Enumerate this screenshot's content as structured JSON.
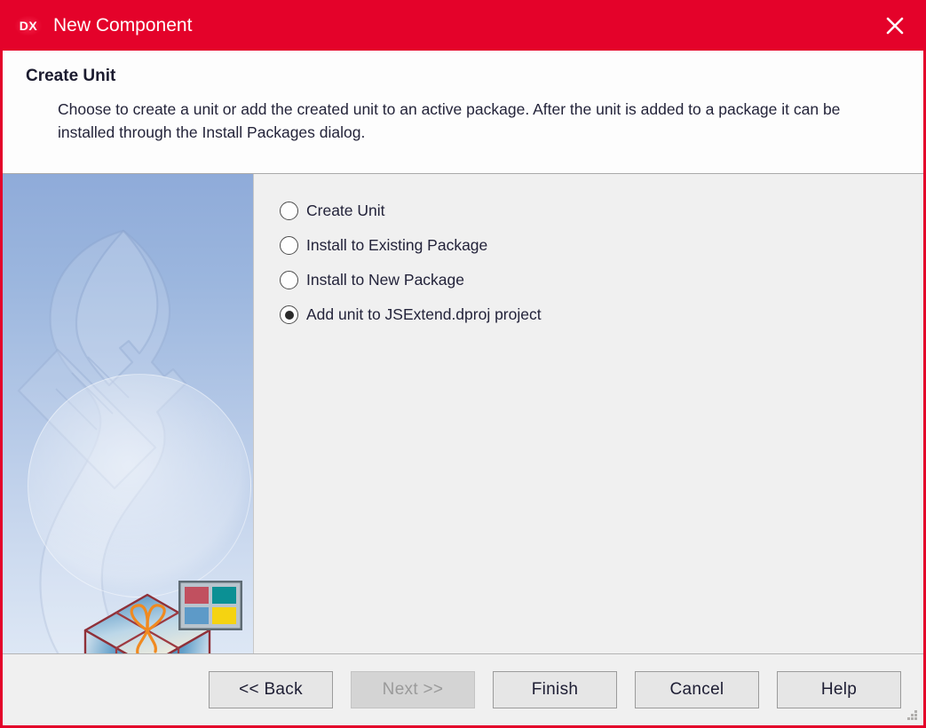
{
  "window": {
    "logo_text": "DX",
    "title": "New Component",
    "close_label": "✕",
    "accent_color": "#e4022a",
    "content_bg": "#f0f0f0"
  },
  "header": {
    "title": "Create Unit",
    "description": "Choose to create a unit or add the created unit to an active package. After the unit is added to a package it can be installed through the Install Packages dialog."
  },
  "side_panel": {
    "wrench_icon": "wrench-watermark-icon",
    "gift_icon": "gift-box-icon",
    "squares_icon": "four-color-squares-icon",
    "square_colors": [
      "#c1505f",
      "#0b9094",
      "#5d9ac8",
      "#f5d311"
    ]
  },
  "options": {
    "group_name": "create-unit-options",
    "items": [
      {
        "label": "Create Unit",
        "selected": false
      },
      {
        "label": "Install to Existing Package",
        "selected": false
      },
      {
        "label": "Install to New Package",
        "selected": false
      },
      {
        "label": "Add unit to JSExtend.dproj project",
        "selected": true
      }
    ]
  },
  "footer": {
    "back_label": "<< Back",
    "next_label": "Next >>",
    "next_disabled": true,
    "finish_label": "Finish",
    "cancel_label": "Cancel",
    "help_label": "Help"
  }
}
